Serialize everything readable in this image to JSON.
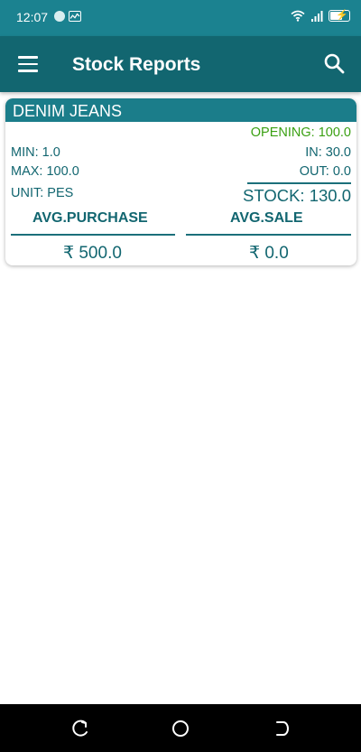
{
  "status_bar": {
    "time": "12:07"
  },
  "app_bar": {
    "title": "Stock Reports"
  },
  "item": {
    "name": "DENIM JEANS",
    "opening": "OPENING: 100.0",
    "min": "MIN: 1.0",
    "max": "MAX: 100.0",
    "unit": "UNIT: PES",
    "in": "IN: 30.0",
    "out": "OUT: 0.0",
    "stock": "STOCK: 130.0",
    "avg_purchase_label": "AVG.PURCHASE",
    "avg_sale_label": "AVG.SALE",
    "avg_purchase_value": "₹ 500.0",
    "avg_sale_value": "₹ 0.0"
  },
  "colors": {
    "status_bar": "#1b8290",
    "app_bar": "#126670",
    "card_header": "#1b7d8a",
    "text_teal": "#126670",
    "opening_green": "#3aa012"
  },
  "icons": {
    "menu": "hamburger-menu-icon",
    "search": "search-icon",
    "nav_back": "back-icon",
    "nav_home": "home-icon",
    "nav_recent": "recent-apps-icon"
  }
}
